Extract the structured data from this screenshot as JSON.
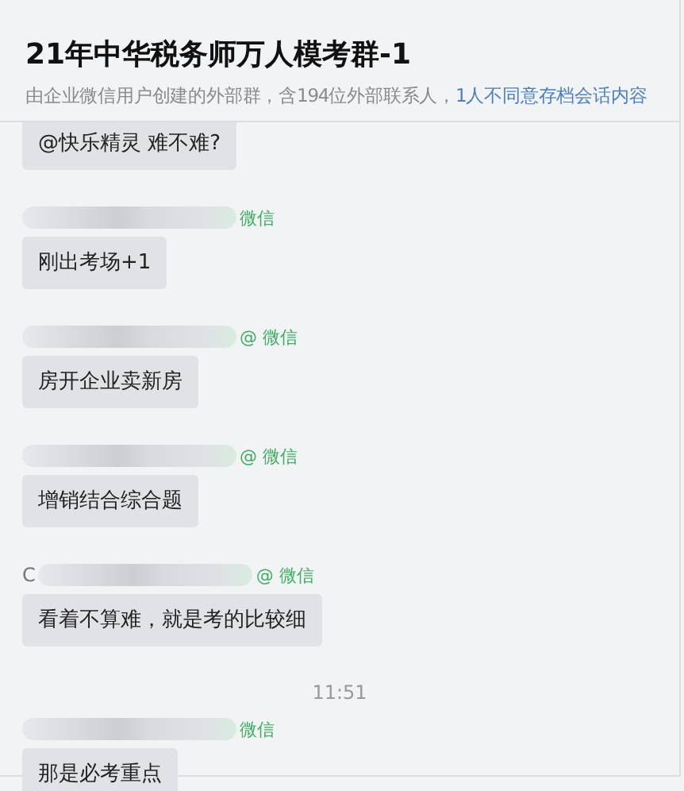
{
  "header": {
    "title": "21年中华税务师万人模考群-1",
    "subtitle": "由企业微信用户创建的外部群，含194位外部联系人，",
    "notice": "1人不同意存档会话内容"
  },
  "messages": [
    {
      "kind": "message",
      "text": "@快乐精灵  难不难?"
    },
    {
      "kind": "message",
      "sender": {
        "suffix": "微信"
      },
      "text": "刚出考场+1"
    },
    {
      "kind": "message",
      "sender": {
        "suffix": "@ 微信"
      },
      "text": "房开企业卖新房"
    },
    {
      "kind": "message",
      "sender": {
        "suffix": "@ 微信"
      },
      "text": "增销结合综合题"
    },
    {
      "kind": "message",
      "sender": {
        "prefix": "C",
        "suffix": "@ 微信"
      },
      "text": "看着不算难，就是考的比较细"
    },
    {
      "kind": "time",
      "text": "11:51"
    },
    {
      "kind": "message",
      "sender": {
        "suffix": "微信"
      },
      "text": "那是必考重点"
    }
  ]
}
